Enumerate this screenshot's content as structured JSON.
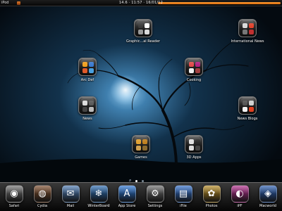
{
  "status_bar": {
    "carrier": "iPod",
    "center": "14.6  ·  11:57  ·  16/01/12"
  },
  "home": {
    "apps": [
      {
        "label": "Graphic...al Reader",
        "icon": "folder-icon",
        "minis": [
          "#3a3a3a",
          "#ffffff",
          "#9a9a9a",
          "#dadada"
        ]
      },
      {
        "label": "International News",
        "icon": "folder-icon",
        "minis": [
          "#d8d8d8",
          "#e0412b",
          "#777777",
          "#c03030"
        ]
      },
      {
        "label": "Arc Def",
        "icon": "folder-icon",
        "minis": [
          "#f0a020",
          "#3a7ad0",
          "#e05a2a",
          "#4aa0e0"
        ]
      },
      {
        "label": "Cooking",
        "icon": "folder-icon",
        "minis": [
          "#e04a4a",
          "#b02080",
          "#f0f0f0",
          "#a04040"
        ]
      },
      {
        "label": "News",
        "icon": "folder-icon",
        "minis": [
          "#dcdcdc",
          "#5a5a5a",
          "#444444",
          "#bbbbbb"
        ]
      },
      {
        "label": "News Blogs",
        "icon": "folder-icon",
        "minis": [
          "#555555",
          "#d0d0d0",
          "#f2f2f2",
          "#e04020"
        ]
      },
      {
        "label": "Games",
        "icon": "folder-icon",
        "minis": [
          "#e0a030",
          "#c08020",
          "#d0a050",
          "#8a6a30"
        ]
      },
      {
        "label": "3D Apps",
        "icon": "folder-icon",
        "minis": [
          "#e0e0e0",
          "#2a2a2a",
          "#dcdcdc",
          "#444444"
        ]
      }
    ]
  },
  "dock": {
    "items": [
      {
        "label": "Safari",
        "icon": "safari-icon",
        "color": "#6f6f6f",
        "glyph": "◉"
      },
      {
        "label": "Cydia",
        "icon": "cydia-icon",
        "color": "#7a4a2a",
        "glyph": "◍"
      },
      {
        "label": "Mail",
        "icon": "mail-icon",
        "color": "#4a78b0",
        "glyph": "✉"
      },
      {
        "label": "WinterBoard",
        "icon": "winterboard-icon",
        "color": "#2a6ab0",
        "glyph": "❄"
      },
      {
        "label": "App Store",
        "icon": "app-store-icon",
        "color": "#2a73d0",
        "glyph": "A"
      },
      {
        "label": "Settings",
        "icon": "settings-icon",
        "color": "#6a6a6a",
        "glyph": "⚙"
      },
      {
        "label": "iFile",
        "icon": "ifile-icon",
        "color": "#2f6cc8",
        "glyph": "▤"
      },
      {
        "label": "Photos",
        "icon": "photos-icon",
        "color": "#b58a22",
        "glyph": "✿"
      },
      {
        "label": "iPF",
        "icon": "ipf-icon",
        "color": "#b02a8a",
        "glyph": "◐"
      },
      {
        "label": "Macworld",
        "icon": "macworld-icon",
        "color": "#2a5db0",
        "glyph": "◈"
      }
    ]
  }
}
